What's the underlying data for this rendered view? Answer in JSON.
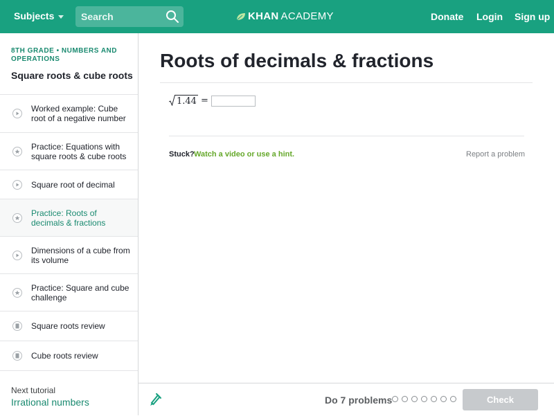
{
  "header": {
    "subjects_label": "Subjects",
    "search_placeholder": "Search",
    "logo_bold": "KHAN",
    "logo_light": "ACADEMY",
    "donate": "Donate",
    "login": "Login",
    "signup": "Sign up"
  },
  "sidebar": {
    "breadcrumb_grade": "8th grade",
    "breadcrumb_sep": "•",
    "breadcrumb_topic": "Numbers and operations",
    "tutorial_title": "Square roots & cube roots",
    "items": [
      {
        "label": "Worked example: Cube root of a negative number",
        "icon": "play-icon",
        "active": false
      },
      {
        "label": "Practice: Equations with square roots & cube roots",
        "icon": "star-icon",
        "active": false
      },
      {
        "label": "Square root of decimal",
        "icon": "play-icon",
        "active": false
      },
      {
        "label": "Practice: Roots of decimals & fractions",
        "icon": "star-icon",
        "active": true
      },
      {
        "label": "Dimensions of a cube from its volume",
        "icon": "play-icon",
        "active": false
      },
      {
        "label": "Practice: Square and cube challenge",
        "icon": "star-icon",
        "active": false
      },
      {
        "label": "Square roots review",
        "icon": "article-icon",
        "active": false
      },
      {
        "label": "Cube roots review",
        "icon": "article-icon",
        "active": false
      }
    ],
    "next_label": "Next tutorial",
    "next_link": "Irrational numbers"
  },
  "main": {
    "title": "Roots of decimals & fractions",
    "problem_radicand": "1.44",
    "problem_equals": "=",
    "answer_value": "",
    "stuck_label": "Stuck?",
    "hint_link": "Watch a video or use a hint.",
    "report_link": "Report a problem"
  },
  "footer": {
    "do_problems": "Do 7 problems",
    "progress_total": 7,
    "progress_done": 0,
    "check_label": "Check"
  },
  "colors": {
    "brand": "#19a180",
    "link": "#1a8a70",
    "hint": "#65a82a",
    "disabled_button": "#c7cacd"
  }
}
